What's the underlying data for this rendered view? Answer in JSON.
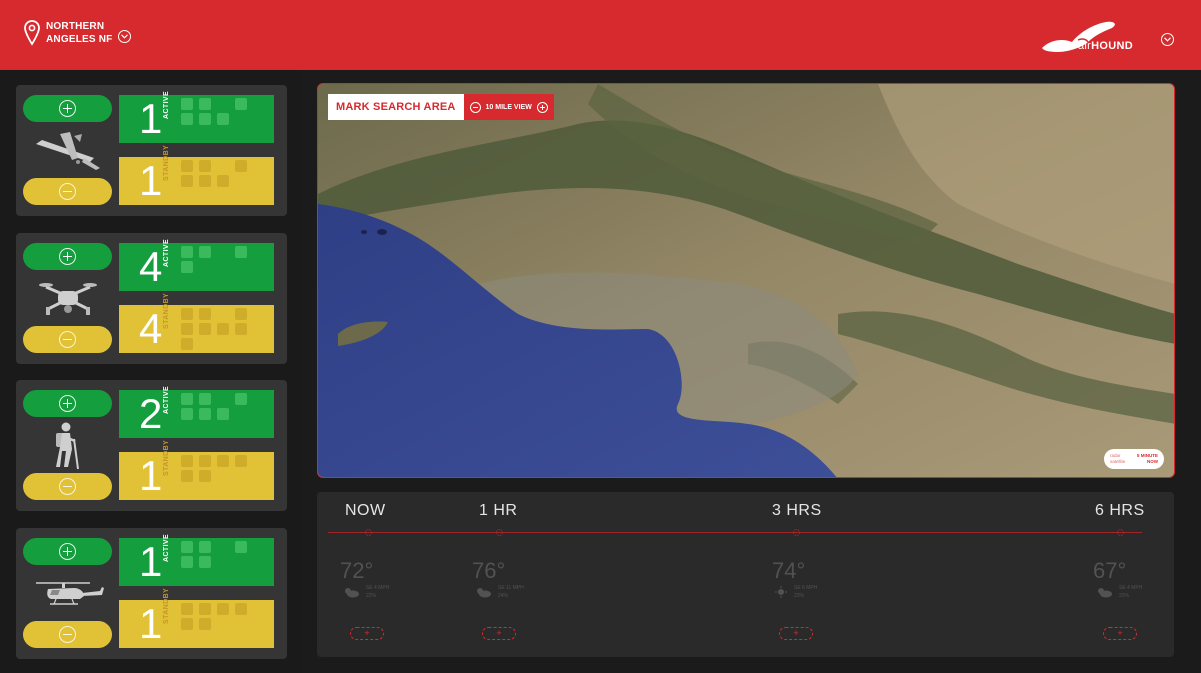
{
  "header": {
    "location_line1": "NORTHERN",
    "location_line2": "ANGELES NF",
    "brand_light": "air",
    "brand_bold": "HOUND",
    "accent_color": "#d62a2e"
  },
  "resources": [
    {
      "vehicle": "fixed-wing-drone",
      "active_count": "1",
      "active_label": "ACTIVE",
      "standby_count": "1",
      "standby_label": "STANDBY"
    },
    {
      "vehicle": "quadcopter-drone",
      "active_count": "4",
      "active_label": "ACTIVE",
      "standby_count": "4",
      "standby_label": "STANDBY"
    },
    {
      "vehicle": "hiker",
      "active_count": "2",
      "active_label": "ACTIVE",
      "standby_count": "1",
      "standby_label": "STANDBY"
    },
    {
      "vehicle": "helicopter",
      "active_count": "1",
      "active_label": "ACTIVE",
      "standby_count": "1",
      "standby_label": "STANDBY"
    }
  ],
  "map": {
    "mark_label": "MARK SEARCH AREA",
    "view_label": "10 MILE VIEW",
    "legend": [
      {
        "key": "radar",
        "value": "5 MINUTE"
      },
      {
        "key": "satellite",
        "value": "NOW"
      }
    ]
  },
  "forecast": [
    {
      "label": "NOW",
      "temp": "72°",
      "wind": "SE 4 MPH",
      "humidity": "22%",
      "icon": "partly-cloudy-icon"
    },
    {
      "label": "1 HR",
      "temp": "76°",
      "wind": "SE 11 MPH",
      "humidity": "24%",
      "icon": "partly-cloudy-icon"
    },
    {
      "label": "3 HRS",
      "temp": "74°",
      "wind": "SE 6 MPH",
      "humidity": "23%",
      "icon": "sunny-icon"
    },
    {
      "label": "6 HRS",
      "temp": "67°",
      "wind": "SE 4 MPH",
      "humidity": "22%",
      "icon": "partly-cloudy-icon"
    }
  ],
  "forecast_add_label": "+"
}
